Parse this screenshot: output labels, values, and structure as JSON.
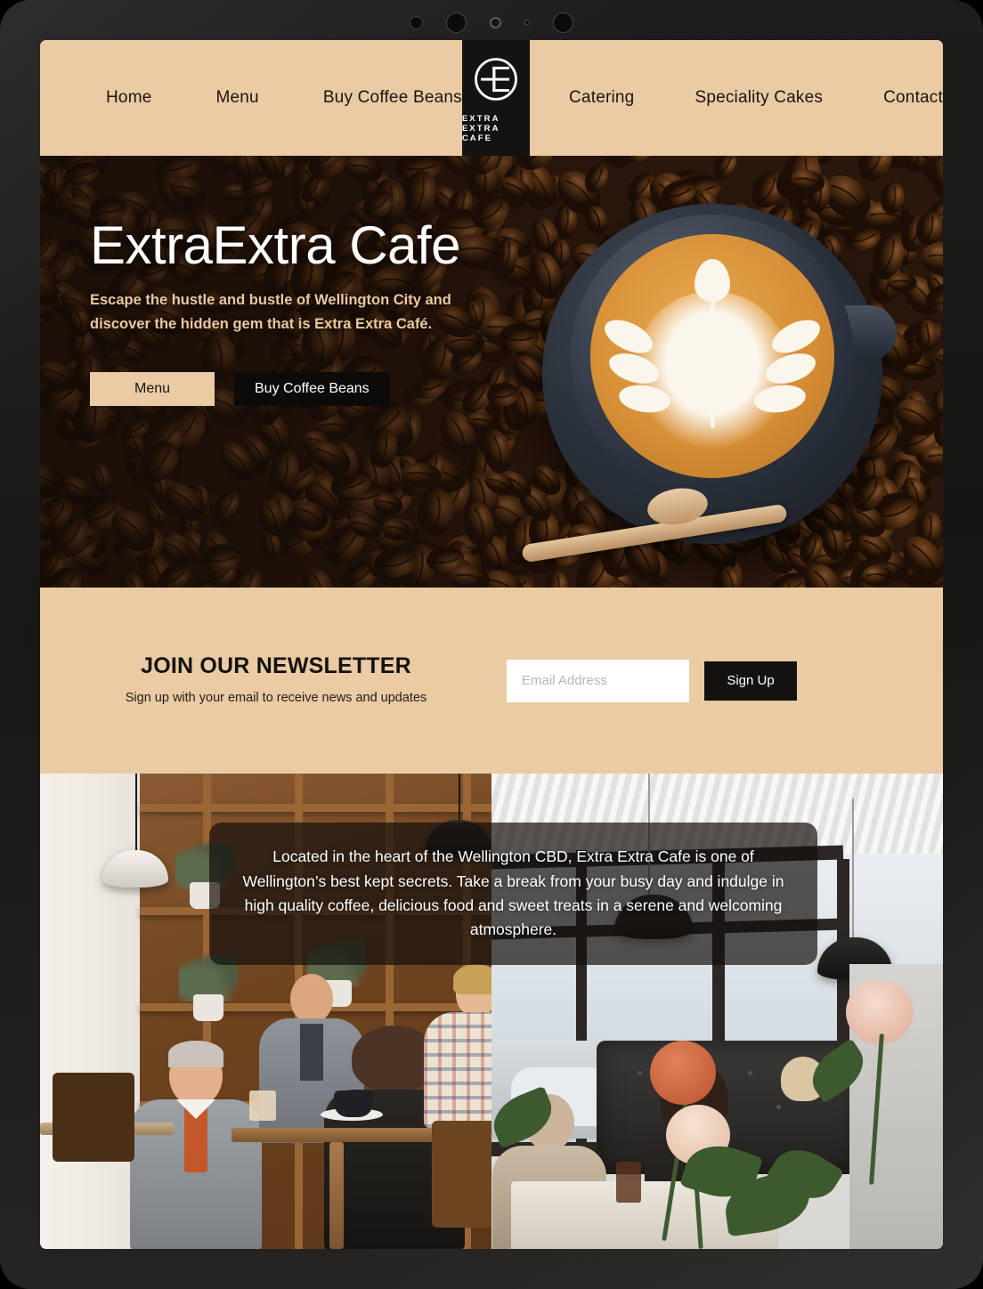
{
  "nav": {
    "left_links": [
      {
        "label": "Home"
      },
      {
        "label": "Menu"
      },
      {
        "label": "Buy Coffee Beans"
      }
    ],
    "right_links": [
      {
        "label": "Catering"
      },
      {
        "label": "Speciality Cakes"
      },
      {
        "label": "Contact"
      }
    ],
    "logo": {
      "icon": "extra-extra-cafe-monogram-icon",
      "wordmark": "EXTRA EXTRA CAFE"
    }
  },
  "hero": {
    "title": "ExtraExtra Cafe",
    "subtitle": "Escape the hustle and bustle of Wellington City and discover the hidden gem that is Extra Extra Café.",
    "primary_button": "Menu",
    "secondary_button": "Buy Coffee Beans",
    "image_alt": "latte-art-coffee-cup-on-beans"
  },
  "newsletter": {
    "title": "JOIN OUR NEWSLETTER",
    "subtitle": "Sign up with your email to receive news and updates",
    "email_value": "",
    "email_placeholder": "Email Address",
    "submit_label": "Sign Up"
  },
  "about": {
    "text": "Located in the heart of the Wellington CBD, Extra Extra Cafe is one of Wellington’s best kept secrets. Take a break from your busy day and indulge in high quality coffee, delicious food and sweet treats in a serene and welcoming atmosphere.",
    "left_image_alt": "cafe-interior-customers-at-table",
    "right_image_alt": "cafe-window-seating-with-flowers"
  },
  "colors": {
    "tan": "#EACBA3",
    "dark": "#141210",
    "white": "#FFFFFF",
    "accent_text": "#E9C8A0"
  }
}
